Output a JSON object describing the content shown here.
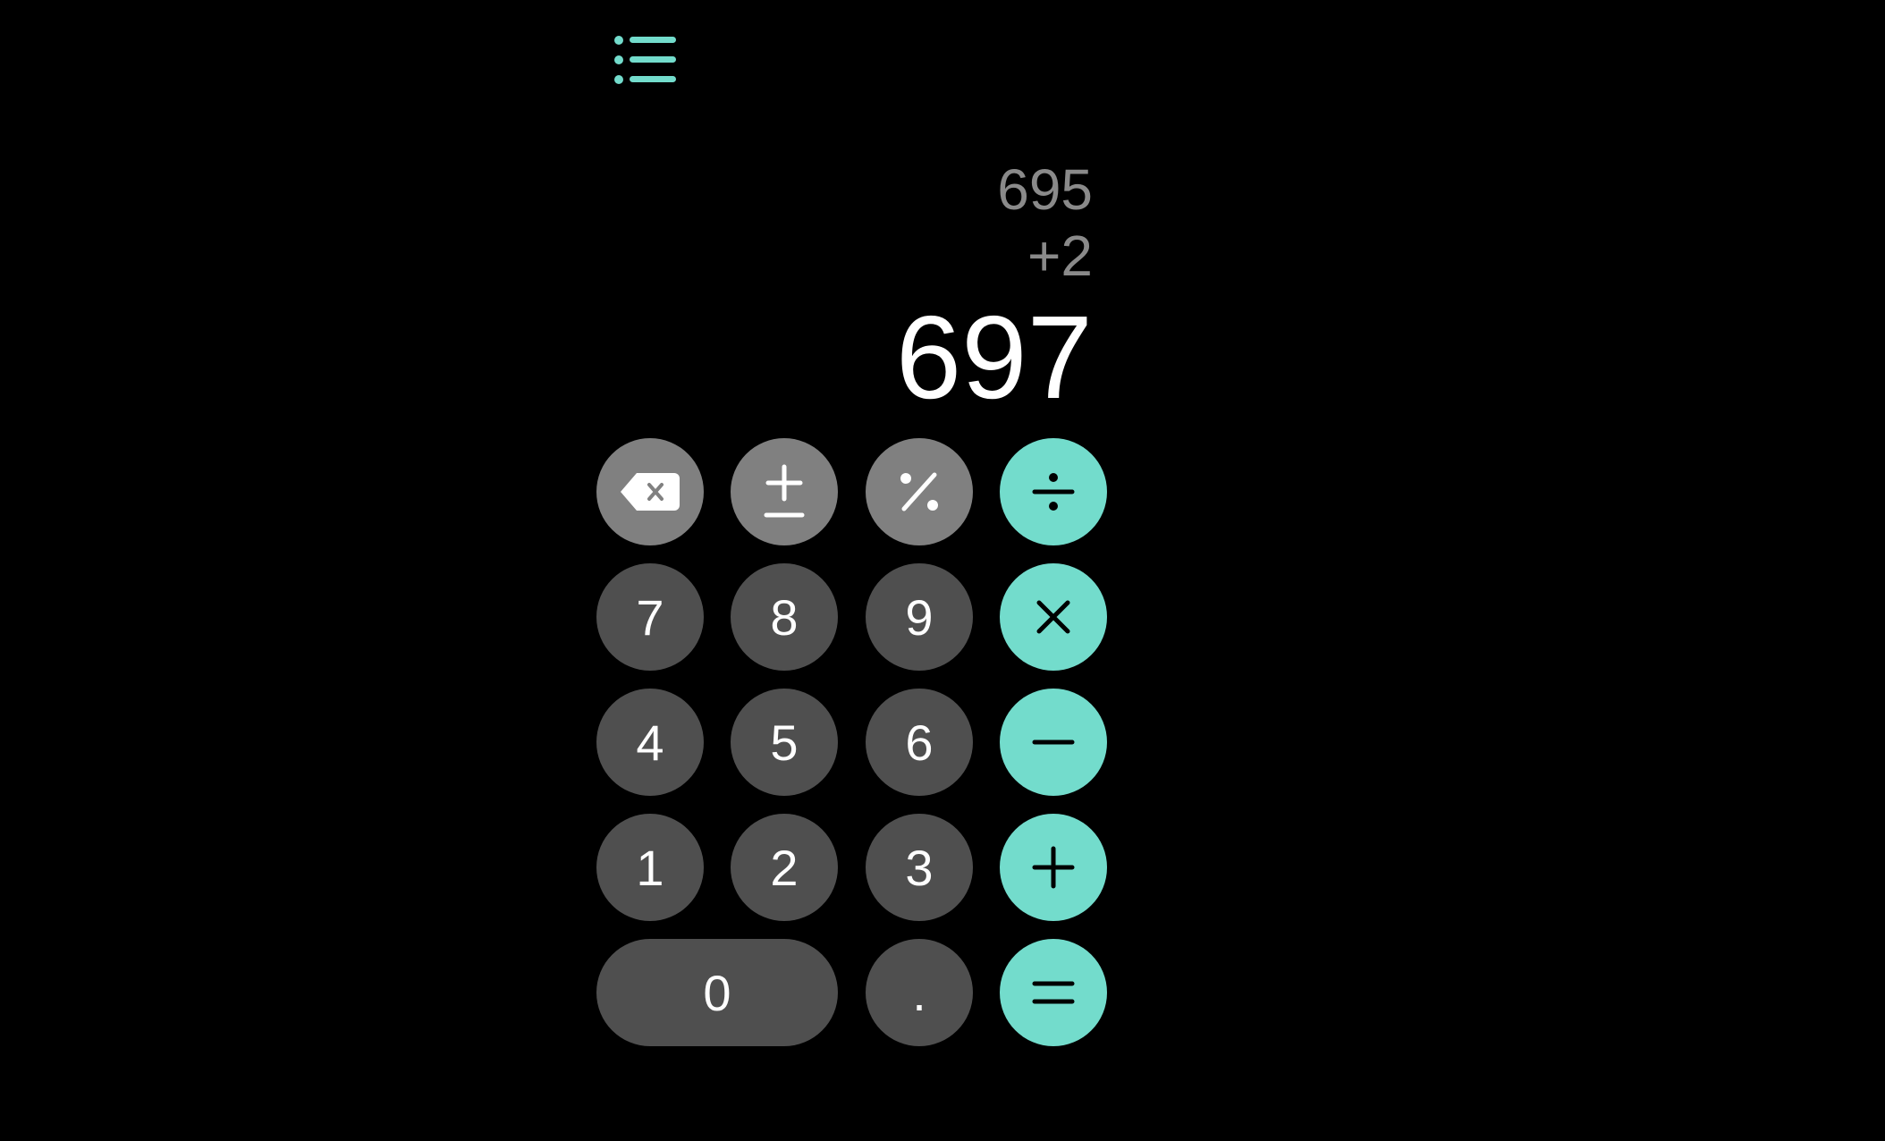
{
  "colors": {
    "background": "#000000",
    "accent": "#73dccc",
    "function_key": "#808080",
    "digit_key": "#4f4f4f",
    "history_text": "#8a8a8a",
    "result_text": "#ffffff"
  },
  "toolbar": {
    "menu_icon": "list-bullet-icon"
  },
  "display": {
    "history": [
      "695",
      "+2"
    ],
    "result": "697"
  },
  "keypad": {
    "backspace_icon": "delete-backward-icon",
    "plus_minus_icon": "plus-minus-icon",
    "percent_icon": "percent-icon",
    "divide_icon": "divide-icon",
    "multiply_icon": "multiply-icon",
    "subtract_icon": "minus-icon",
    "add_icon": "plus-icon",
    "equals_icon": "equals-icon",
    "digits": {
      "seven": "7",
      "eight": "8",
      "nine": "9",
      "four": "4",
      "five": "5",
      "six": "6",
      "one": "1",
      "two": "2",
      "three": "3",
      "zero": "0"
    },
    "decimal": "."
  }
}
